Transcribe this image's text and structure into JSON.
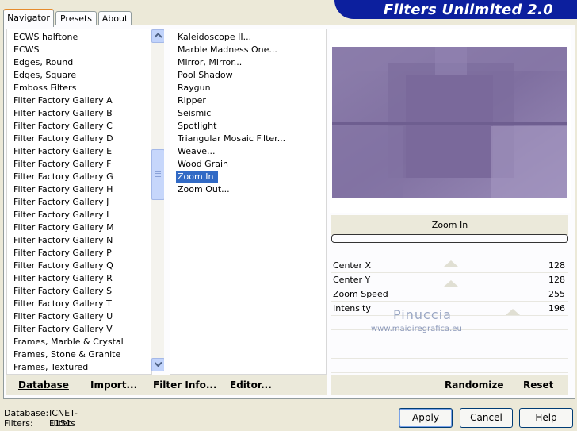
{
  "tabs": [
    {
      "label": "Navigator"
    },
    {
      "label": "Presets"
    },
    {
      "label": "About"
    }
  ],
  "banner": {
    "title": "Filters Unlimited 2.0"
  },
  "categories": [
    "ECWS halftone",
    "ECWS",
    "Edges, Round",
    "Edges, Square",
    "Emboss Filters",
    "Filter Factory Gallery A",
    "Filter Factory Gallery B",
    "Filter Factory Gallery C",
    "Filter Factory Gallery D",
    "Filter Factory Gallery E",
    "Filter Factory Gallery F",
    "Filter Factory Gallery G",
    "Filter Factory Gallery H",
    "Filter Factory Gallery J",
    "Filter Factory Gallery L",
    "Filter Factory Gallery M",
    "Filter Factory Gallery N",
    "Filter Factory Gallery P",
    "Filter Factory Gallery Q",
    "Filter Factory Gallery R",
    "Filter Factory Gallery S",
    "Filter Factory Gallery T",
    "Filter Factory Gallery U",
    "Filter Factory Gallery V",
    "Frames, Marble & Crystal",
    "Frames, Stone & Granite",
    "Frames, Textured"
  ],
  "selected_category": "Filter Factory Gallery A",
  "filters": [
    "Kaleidoscope II...",
    "Marble Madness One...",
    "Mirror, Mirror...",
    "Pool Shadow",
    "Raygun",
    "Ripper",
    "Seismic",
    "Spotlight",
    "Triangular Mosaic Filter...",
    "Weave...",
    "Wood Grain",
    "Zoom In",
    "Zoom Out..."
  ],
  "selected_filter": "Zoom In",
  "filter_name": "Zoom In",
  "params": [
    {
      "label": "Center X",
      "value": "128"
    },
    {
      "label": "Center Y",
      "value": "128"
    },
    {
      "label": "Zoom Speed",
      "value": "255"
    },
    {
      "label": "Intensity",
      "value": "196"
    }
  ],
  "watermark": {
    "name": "Pinuccia",
    "url": "www.maidiregrafica.eu"
  },
  "left_toolbar": {
    "database": "Database",
    "import": "Import...",
    "filter_info": "Filter Info...",
    "editor": "Editor..."
  },
  "right_toolbar": {
    "randomize": "Randomize",
    "reset": "Reset"
  },
  "status": {
    "database_label": "Database:",
    "database_value": "ICNET-Filters",
    "filters_label": "Filters:",
    "filters_value": "1151"
  },
  "buttons": {
    "apply": "Apply",
    "cancel": "Cancel",
    "help": "Help"
  },
  "colors": {
    "banner": "#0c1f9e",
    "selection": "#316ac5",
    "preview": "#8a7aa8"
  }
}
